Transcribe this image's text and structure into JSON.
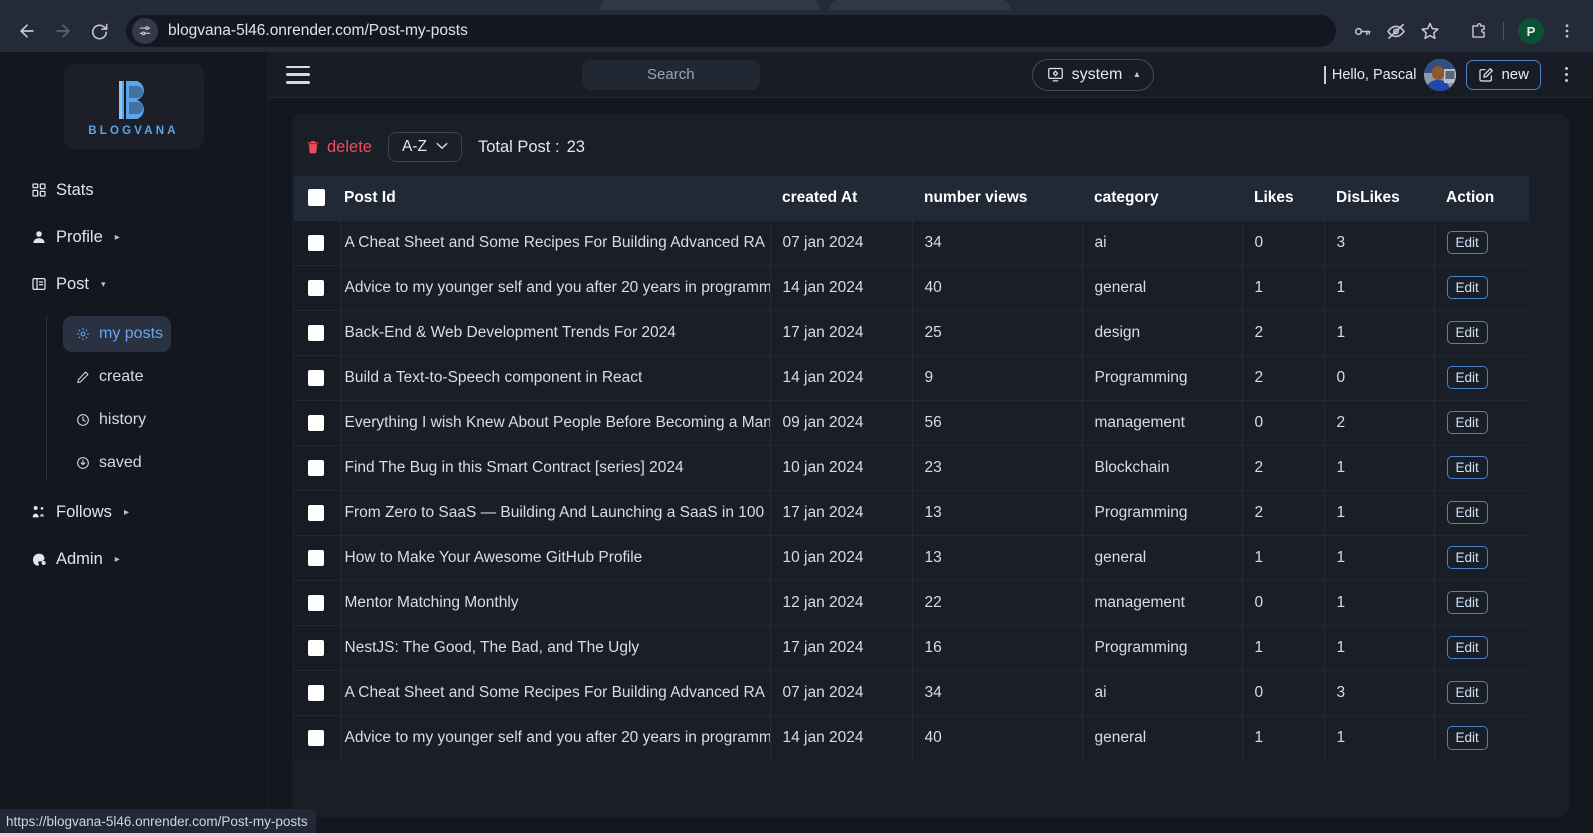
{
  "browser": {
    "url": "blogvana-5l46.onrender.com/Post-my-posts",
    "back_label": "Back",
    "forward_label": "Forward",
    "reload_label": "Reload",
    "site_info_label": "View site information",
    "passwords_label": "Passwords",
    "incognito_eye_label": "Hide",
    "bookmark_label": "Bookmark this tab",
    "extensions_label": "Extensions",
    "profile_initial": "P",
    "menu_label": "Customize and control",
    "status_url": "https://blogvana-5l46.onrender.com/Post-my-posts"
  },
  "sidebar": {
    "brand": "BLOGVANA",
    "items": [
      {
        "label": "Stats",
        "icon": "dashboard-icon",
        "caret": ""
      },
      {
        "label": "Profile",
        "icon": "user-icon",
        "caret": "▸"
      },
      {
        "label": "Post",
        "icon": "panel-icon",
        "caret": "▾"
      }
    ],
    "submenu": [
      {
        "label": "my posts",
        "icon": "gear-icon",
        "active": true
      },
      {
        "label": "create",
        "icon": "pencil-icon",
        "active": false
      },
      {
        "label": "history",
        "icon": "clock-icon",
        "active": false
      },
      {
        "label": "saved",
        "icon": "save-icon",
        "active": false
      }
    ],
    "items_after": [
      {
        "label": "Follows",
        "icon": "follows-icon",
        "caret": "▸"
      },
      {
        "label": "Admin",
        "icon": "admin-icon",
        "caret": "▸"
      }
    ]
  },
  "header": {
    "menu_label": "Toggle sidebar",
    "search_placeholder": "Search",
    "search_value": "",
    "theme_label": "system",
    "theme_caret": "▴",
    "greeting": "Hello, Pascal",
    "new_label": "new",
    "kebab_label": "More options"
  },
  "toolbar": {
    "delete_label": "delete",
    "sort_label": "A-Z",
    "sort_caret": "∨",
    "total_label": "Total Post :",
    "total_value": "23"
  },
  "table": {
    "columns": [
      "Post Id",
      "created At",
      "number views",
      "category",
      "Likes",
      "DisLikes",
      "Action"
    ],
    "action_label": "Edit",
    "rows": [
      {
        "post_id": "A Cheat Sheet and Some Recipes For Building Advanced RA",
        "created_at": "07 jan 2024",
        "views": "34",
        "category": "ai",
        "likes": "0",
        "dislikes": "3"
      },
      {
        "post_id": "Advice to my younger self and you after 20 years in programm",
        "created_at": "14 jan 2024",
        "views": "40",
        "category": "general",
        "likes": "1",
        "dislikes": "1"
      },
      {
        "post_id": "Back-End & Web Development Trends For 2024",
        "created_at": "17 jan 2024",
        "views": "25",
        "category": "design",
        "likes": "2",
        "dislikes": "1"
      },
      {
        "post_id": "Build a Text-to-Speech component in React",
        "created_at": "14 jan 2024",
        "views": "9",
        "category": "Programming",
        "likes": "2",
        "dislikes": "0"
      },
      {
        "post_id": "Everything I wish Knew About People Before Becoming a Man",
        "created_at": "09 jan 2024",
        "views": "56",
        "category": "management",
        "likes": "0",
        "dislikes": "2"
      },
      {
        "post_id": "Find The Bug in this Smart Contract [series] 2024",
        "created_at": "10 jan 2024",
        "views": "23",
        "category": "Blockchain",
        "likes": "2",
        "dislikes": "1"
      },
      {
        "post_id": "From Zero to SaaS — Building And Launching a SaaS in 100",
        "created_at": "17 jan 2024",
        "views": "13",
        "category": "Programming",
        "likes": "2",
        "dislikes": "1"
      },
      {
        "post_id": "How to Make Your Awesome GitHub Profile",
        "created_at": "10 jan 2024",
        "views": "13",
        "category": "general",
        "likes": "1",
        "dislikes": "1"
      },
      {
        "post_id": "Mentor Matching Monthly",
        "created_at": "12 jan 2024",
        "views": "22",
        "category": "management",
        "likes": "0",
        "dislikes": "1"
      },
      {
        "post_id": "NestJS: The Good, The Bad, and The Ugly",
        "created_at": "17 jan 2024",
        "views": "16",
        "category": "Programming",
        "likes": "1",
        "dislikes": "1"
      },
      {
        "post_id": "A Cheat Sheet and Some Recipes For Building Advanced RA",
        "created_at": "07 jan 2024",
        "views": "34",
        "category": "ai",
        "likes": "0",
        "dislikes": "3"
      },
      {
        "post_id": "Advice to my younger self and you after 20 years in programm",
        "created_at": "14 jan 2024",
        "views": "40",
        "category": "general",
        "likes": "1",
        "dislikes": "1"
      }
    ]
  },
  "colors": {
    "brand_blue": "#5ba4e8",
    "danger_red": "#ef4b5e",
    "accent_border": "#4d82c4",
    "header_row": "#212836",
    "panel": "#1a1e27"
  }
}
